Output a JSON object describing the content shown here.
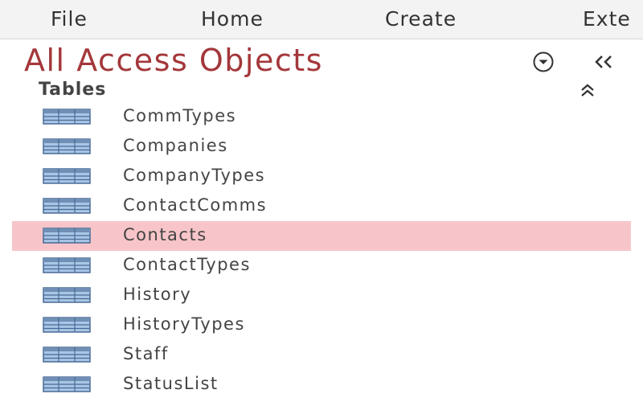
{
  "ribbon": {
    "tabs": [
      {
        "label": "File"
      },
      {
        "label": "Home"
      },
      {
        "label": "Create"
      },
      {
        "label": "Exte"
      }
    ]
  },
  "nav_pane": {
    "title": "All Access Objects",
    "menu_icon": "chevron-down-circle-icon",
    "collapse_icon": "double-chevron-left-icon",
    "group": {
      "label": "Tables",
      "toggle_icon": "double-chevron-up-icon",
      "items": [
        {
          "label": "CommTypes",
          "icon": "table-icon",
          "selected": false
        },
        {
          "label": "Companies",
          "icon": "table-icon",
          "selected": false
        },
        {
          "label": "CompanyTypes",
          "icon": "table-icon",
          "selected": false
        },
        {
          "label": "ContactComms",
          "icon": "table-icon",
          "selected": false
        },
        {
          "label": "Contacts",
          "icon": "table-icon",
          "selected": true
        },
        {
          "label": "ContactTypes",
          "icon": "table-icon",
          "selected": false
        },
        {
          "label": "History",
          "icon": "table-icon",
          "selected": false
        },
        {
          "label": "HistoryTypes",
          "icon": "table-icon",
          "selected": false
        },
        {
          "label": "Staff",
          "icon": "table-icon",
          "selected": false
        },
        {
          "label": "StatusList",
          "icon": "table-icon",
          "selected": false
        }
      ]
    }
  },
  "colors": {
    "title": "#a4373a",
    "selected_row": "#f7c5c9",
    "icon_fill": "#a9c6e6",
    "icon_header": "#6f8fb5",
    "icon_line": "#4a6a95"
  }
}
